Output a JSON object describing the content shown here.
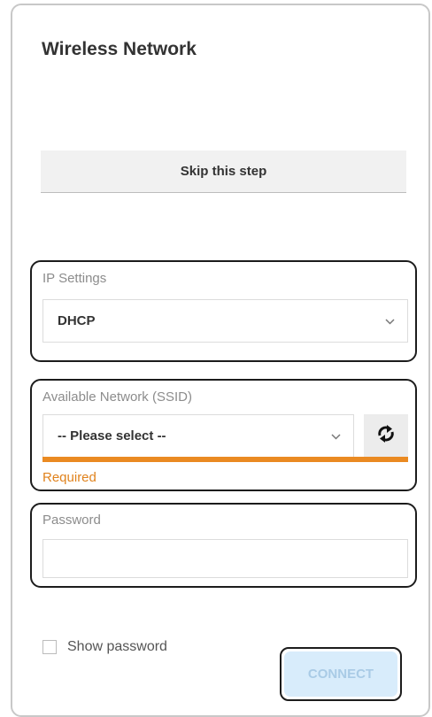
{
  "header": {
    "title": "Wireless Network"
  },
  "skip": {
    "label": "Skip this step"
  },
  "ip_settings": {
    "label": "IP Settings",
    "value": "DHCP"
  },
  "network": {
    "label": "Available Network (SSID)",
    "value": "-- Please select --",
    "error": "Required"
  },
  "password": {
    "label": "Password",
    "value": ""
  },
  "show_password": {
    "label": "Show password",
    "checked": false
  },
  "connect": {
    "label": "CONNECT"
  },
  "colors": {
    "accent_error": "#ea8a22",
    "connect_bg": "#d8ecfb"
  }
}
